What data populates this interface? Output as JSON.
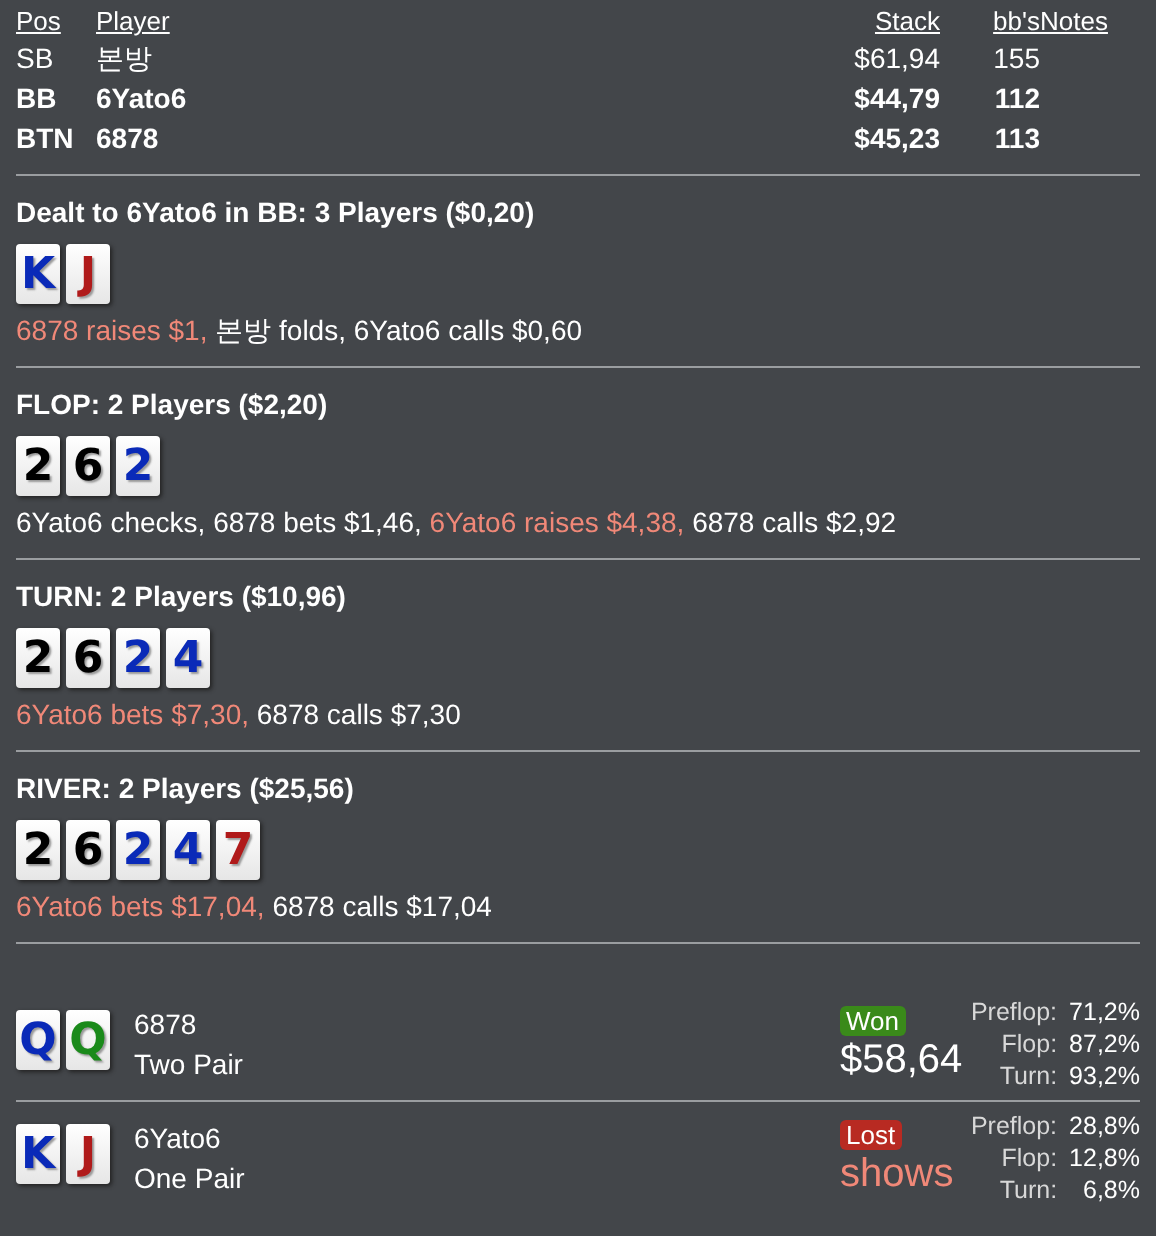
{
  "players_table": {
    "columns": [
      "Pos",
      "Player",
      "Stack",
      "bb's",
      "Notes"
    ],
    "rows": [
      {
        "pos": "SB",
        "player": "본방",
        "stack": "$61,94",
        "bbs": "155",
        "hero": false
      },
      {
        "pos": "BB",
        "player": "6Yato6",
        "stack": "$44,79",
        "bbs": "112",
        "hero": true
      },
      {
        "pos": "BTN",
        "player": "6878",
        "stack": "$45,23",
        "bbs": "113",
        "hero": true
      }
    ]
  },
  "streets": [
    {
      "title": "Dealt to 6Yato6 in BB: 3 Players ($0,20)",
      "cards": [
        {
          "rank": "K",
          "color": "#0a2ab8"
        },
        {
          "rank": "J",
          "color": "#b01a1a"
        }
      ],
      "actions": [
        {
          "text": "6878 raises $1,",
          "aggressive": true
        },
        {
          "text": "본방 folds, 6Yato6 calls $0,60",
          "aggressive": false
        }
      ]
    },
    {
      "title": "FLOP: 2 Players ($2,20)",
      "cards": [
        {
          "rank": "2",
          "color": "#000000"
        },
        {
          "rank": "6",
          "color": "#000000"
        },
        {
          "rank": "2",
          "color": "#0a2ab8"
        }
      ],
      "actions": [
        {
          "text": "6Yato6 checks, 6878 bets $1,46,",
          "aggressive": false
        },
        {
          "text": "6Yato6 raises $4,38,",
          "aggressive": true
        },
        {
          "text": "6878 calls $2,92",
          "aggressive": false
        }
      ]
    },
    {
      "title": "TURN: 2 Players ($10,96)",
      "cards": [
        {
          "rank": "2",
          "color": "#000000"
        },
        {
          "rank": "6",
          "color": "#000000"
        },
        {
          "rank": "2",
          "color": "#0a2ab8"
        },
        {
          "rank": "4",
          "color": "#0a2ab8"
        }
      ],
      "actions": [
        {
          "text": "6Yato6 bets $7,30,",
          "aggressive": true
        },
        {
          "text": "6878 calls $7,30",
          "aggressive": false
        }
      ]
    },
    {
      "title": "RIVER: 2 Players ($25,56)",
      "cards": [
        {
          "rank": "2",
          "color": "#000000"
        },
        {
          "rank": "6",
          "color": "#000000"
        },
        {
          "rank": "2",
          "color": "#0a2ab8"
        },
        {
          "rank": "4",
          "color": "#0a2ab8"
        },
        {
          "rank": "7",
          "color": "#b01a1a"
        }
      ],
      "actions": [
        {
          "text": "6Yato6 bets $17,04,",
          "aggressive": true
        },
        {
          "text": "6878 calls $17,04",
          "aggressive": false
        }
      ]
    }
  ],
  "showdown": [
    {
      "cards": [
        {
          "rank": "Q",
          "color": "#0a2ab8"
        },
        {
          "rank": "Q",
          "color": "#1a8a1a"
        }
      ],
      "player": "6878",
      "hand": "Two Pair",
      "result": {
        "kind": "won",
        "badge": "Won",
        "amount": "$58,64"
      },
      "equity": [
        {
          "label": "Preflop:",
          "value": "71,2%"
        },
        {
          "label": "Flop:",
          "value": "87,2%"
        },
        {
          "label": "Turn:",
          "value": "93,2%"
        }
      ]
    },
    {
      "cards": [
        {
          "rank": "K",
          "color": "#0a2ab8"
        },
        {
          "rank": "J",
          "color": "#b01a1a"
        }
      ],
      "player": "6Yato6",
      "hand": "One Pair",
      "result": {
        "kind": "lost",
        "badge": "Lost",
        "amount": "shows"
      },
      "equity": [
        {
          "label": "Preflop:",
          "value": "28,8%"
        },
        {
          "label": "Flop:",
          "value": "12,8%"
        },
        {
          "label": "Turn:",
          "value": "6,8%"
        }
      ]
    }
  ]
}
